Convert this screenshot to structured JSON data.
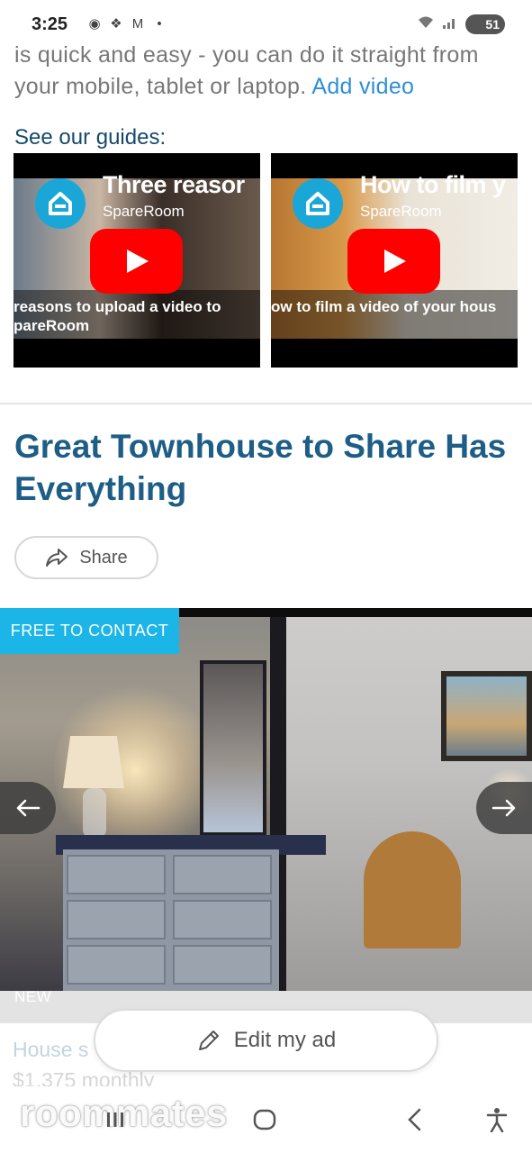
{
  "status_bar": {
    "time": "3:25",
    "battery": "51",
    "network": "6"
  },
  "intro": {
    "text": "is quick and easy - you can do it straight from your mobile, tablet or laptop.",
    "link_label": "Add video"
  },
  "guides": {
    "title": "See our guides:",
    "videos": [
      {
        "title": "Three reasor",
        "channel": "SpareRoom",
        "caption_line1": "reasons to upload a video to",
        "caption_line2": "pareRoom"
      },
      {
        "title": "How to film y",
        "channel": "SpareRoom",
        "caption_line1": "ow to film a video of your hous",
        "caption_line2": ""
      }
    ]
  },
  "listing": {
    "title": "Great Townhouse to Share Has Everything",
    "share_label": "Share",
    "badge": "FREE TO CONTACT",
    "new_label": "NEW",
    "next_title_partial": "House s",
    "next_price_partial": "$1,375 monthly",
    "edit_label": "Edit my ad"
  },
  "watermark": "roommates",
  "colors": {
    "accent": "#1cb5e8",
    "title_blue": "#1d5d86",
    "link_blue": "#2e8fd6",
    "youtube_red": "#ff0000"
  }
}
